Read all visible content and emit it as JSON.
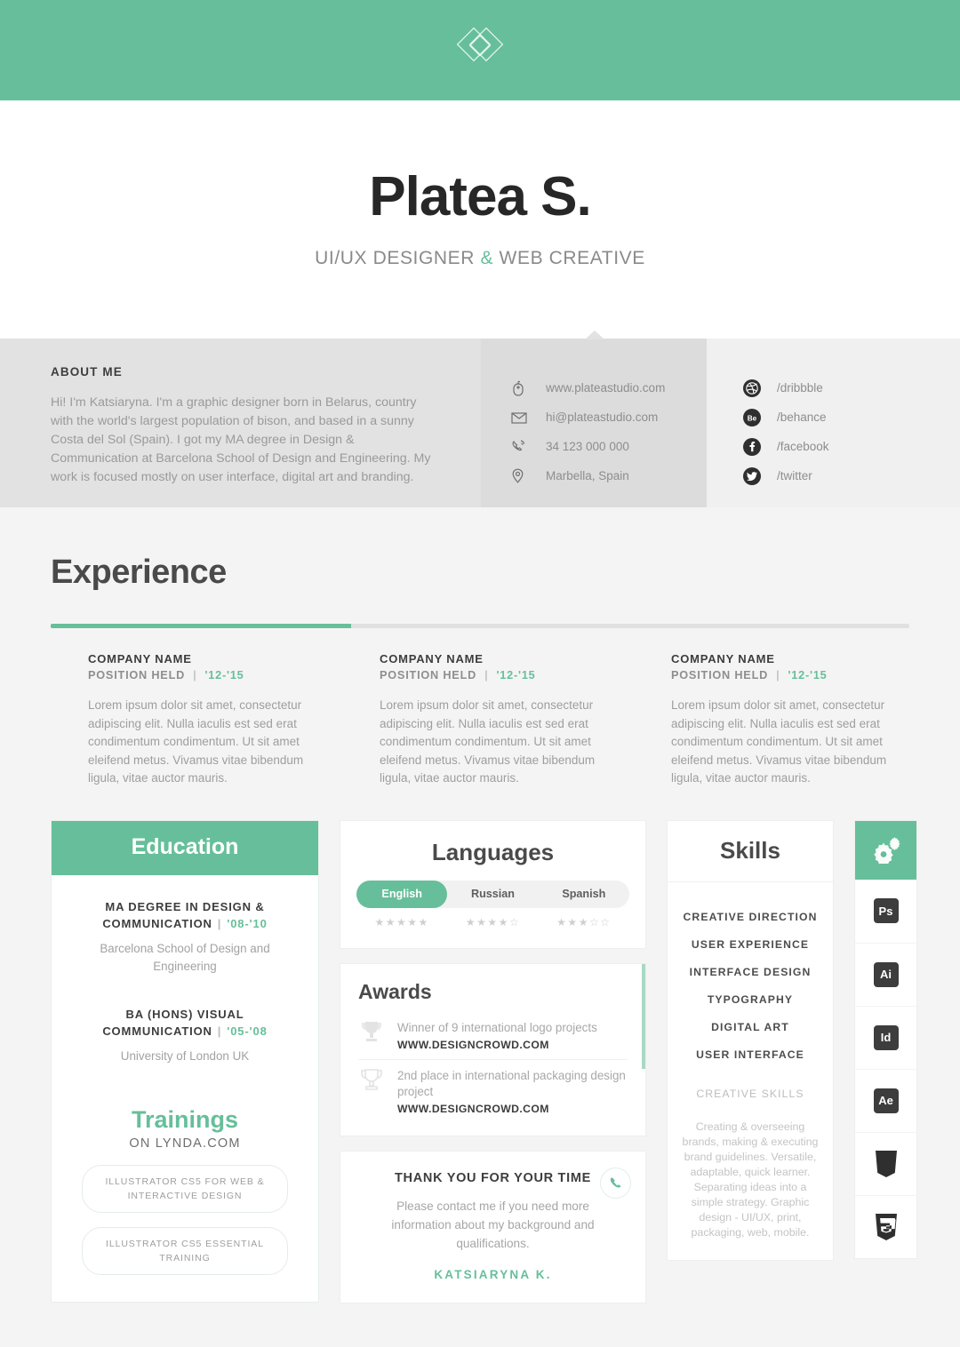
{
  "header": {
    "logo_icon": "double-diamond-logo"
  },
  "identity": {
    "name": "Platea S.",
    "tagline_before": "UI/UX DESIGNER ",
    "tagline_amp": "&",
    "tagline_after": " WEB CREATIVE"
  },
  "about": {
    "heading": "ABOUT ME",
    "body": "Hi! I'm Katsiaryna. I'm a graphic designer born in Belarus, country with the world's largest population of bison, and based in a sunny Costa del Sol (Spain). I got my MA degree in Design & Communication at Barcelona School of Design and Engineering. My work is focused mostly on user interface, digital art and branding."
  },
  "contact": {
    "items": [
      {
        "icon": "mouse-icon",
        "value": "www.plateastudio.com"
      },
      {
        "icon": "envelope-icon",
        "value": "hi@plateastudio.com"
      },
      {
        "icon": "phone-icon",
        "value": "34 123 000 000"
      },
      {
        "icon": "location-pin-icon",
        "value": "Marbella, Spain"
      }
    ]
  },
  "social": {
    "items": [
      {
        "icon": "dribbble-icon",
        "value": "/dribbble"
      },
      {
        "icon": "behance-icon",
        "value": "/behance"
      },
      {
        "icon": "facebook-icon",
        "value": "/facebook"
      },
      {
        "icon": "twitter-icon",
        "value": "/twitter"
      }
    ]
  },
  "experience": {
    "title": "Experience",
    "progress_percent": 35,
    "entries": [
      {
        "company": "COMPANY NAME",
        "position": "POSITION HELD",
        "separator": "|",
        "years": "'12-'15",
        "body": "Lorem ipsum dolor sit amet, consectetur adipiscing elit. Nulla iaculis est sed erat condimentum condimentum. Ut sit amet eleifend metus. Vivamus vitae bibendum ligula, vitae auctor mauris."
      },
      {
        "company": "COMPANY NAME",
        "position": "POSITION HELD",
        "separator": "|",
        "years": "'12-'15",
        "body": "Lorem ipsum dolor sit amet, consectetur adipiscing elit. Nulla iaculis est sed erat condimentum condimentum. Ut sit amet eleifend metus. Vivamus vitae bibendum ligula, vitae auctor mauris."
      },
      {
        "company": "COMPANY NAME",
        "position": "POSITION HELD",
        "separator": "|",
        "years": "'12-'15",
        "body": "Lorem ipsum dolor sit amet, consectetur adipiscing elit. Nulla iaculis est sed erat condimentum condimentum. Ut sit amet eleifend metus. Vivamus vitae bibendum ligula, vitae auctor mauris."
      }
    ]
  },
  "education": {
    "heading": "Education",
    "entries": [
      {
        "degree": "MA DEGREE IN DESIGN & COMMUNICATION",
        "separator": "|",
        "years": "'08-'10",
        "school": "Barcelona School of Design and Engineering"
      },
      {
        "degree": "BA (HONS) VISUAL COMMUNICATION",
        "separator": "|",
        "years": "'05-'08",
        "school": "University of London UK"
      }
    ],
    "trainings_title": "Trainings",
    "trainings_subtitle": "ON LYNDA.COM",
    "trainings": [
      "ILLUSTRATOR CS5 FOR WEB & INTERACTIVE DESIGN",
      "ILLUSTRATOR CS5 ESSENTIAL TRAINING"
    ]
  },
  "languages": {
    "heading": "Languages",
    "items": [
      {
        "label": "English",
        "active": true,
        "rating": 5,
        "max": 5
      },
      {
        "label": "Russian",
        "active": false,
        "rating": 4,
        "max": 5
      },
      {
        "label": "Spanish",
        "active": false,
        "rating": 3,
        "max": 5
      }
    ]
  },
  "awards": {
    "heading": "Awards",
    "items": [
      {
        "icon": "trophy-icon",
        "description": "Winner of 9 international logo projects",
        "url": "WWW.DESIGNCROWD.COM"
      },
      {
        "icon": "trophy-icon",
        "description": "2nd place in international packaging design project",
        "url": "WWW.DESIGNCROWD.COM"
      }
    ]
  },
  "thanks": {
    "heading": "THANK YOU FOR YOUR TIME",
    "body": "Please contact me if you need more information about my background and qualifications.",
    "signature": "KATSIARYNA K.",
    "badge_icon": "phone-icon"
  },
  "skills": {
    "heading": "Skills",
    "items": [
      "CREATIVE DIRECTION",
      "USER EXPERIENCE",
      "INTERFACE DESIGN",
      "TYPOGRAPHY",
      "DIGITAL ART",
      "USER INTERFACE"
    ],
    "creative_heading": "CREATIVE SKILLS",
    "creative_body": "Creating & overseeing brands, making & executing brand guidelines. Versatile, adaptable, quick learner. Separating ideas into a simple strategy. Graphic design - UI/UX, print, packaging, web, mobile."
  },
  "software": {
    "header_icon": "gears-icon",
    "items": [
      {
        "icon": "photoshop-icon",
        "label": "Ps"
      },
      {
        "icon": "illustrator-icon",
        "label": "Ai"
      },
      {
        "icon": "indesign-icon",
        "label": "Id"
      },
      {
        "icon": "aftereffects-icon",
        "label": "Ae"
      },
      {
        "icon": "css3-icon",
        "label": ""
      },
      {
        "icon": "html5-icon",
        "label": ""
      }
    ]
  },
  "colors": {
    "accent_green": "#66bf9a",
    "accent_green_light": "#a8d9c3",
    "dark_text": "#3d3d3d",
    "muted_text": "#9e9e9e",
    "page_bg": "#f4f4f4"
  }
}
